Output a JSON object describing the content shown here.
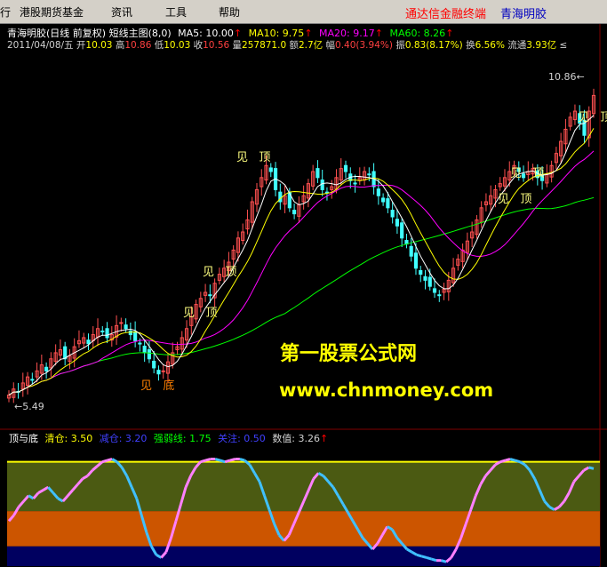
{
  "menubar": {
    "items": [
      "行",
      "港股期货基金",
      "资讯",
      "工具",
      "帮助"
    ],
    "brand": "通达信金融终端",
    "stock_name": "青海明胶"
  },
  "header": {
    "title": "青海明胶(日线 前复权) 短线主图(8,0)",
    "ma": [
      {
        "label": "MA5: 10.00",
        "color": "#ffffff"
      },
      {
        "label": "MA10: 9.75",
        "color": "#ffff00"
      },
      {
        "label": "MA20: 9.17",
        "color": "#ff00ff"
      },
      {
        "label": "MA60: 8.26",
        "color": "#00ff00"
      }
    ],
    "quote": {
      "date": "2011/04/08/五",
      "open_label": "开",
      "open": "10.03",
      "high_label": "高",
      "high": "10.86",
      "low_label": "低",
      "low": "10.03",
      "close_label": "收",
      "close": "10.56",
      "volume_label": "量",
      "volume": "257871.0",
      "amount_label": "额",
      "amount": "2.7亿",
      "change_label": "幅",
      "change": "0.40(3.94%)",
      "amplitude_label": "振",
      "amplitude": "0.83(8.17%)",
      "turnover_label": "换",
      "turnover": "6.56%",
      "float_label": "流通",
      "float": "3.93亿",
      "trailing": "≤"
    },
    "up_arrow": "↑"
  },
  "price_labels": {
    "high": "10.86",
    "low": "5.49",
    "high_arrow": "←",
    "low_arrow": "←"
  },
  "signals": {
    "top_a": "见",
    "top_b": "顶",
    "bottom_a": "见",
    "bottom_b": "底"
  },
  "watermark": {
    "line1": "第一股票公式网",
    "line2": "www.chnmoney.com"
  },
  "indicator": {
    "name": "顶与底",
    "items": [
      {
        "label": "清仓: 3.50",
        "color": "#ffff00"
      },
      {
        "label": "减仓: 3.20",
        "color": "#4040ff"
      },
      {
        "label": "强弱线: 1.75",
        "color": "#00ff00"
      },
      {
        "label": "关注: 0.50",
        "color": "#4040ff"
      },
      {
        "label": "数值: 3.26",
        "color": "#d0d0d0"
      }
    ]
  },
  "colors": {
    "background": "#000000",
    "up_candle": "#ff5050",
    "down_candle": "#40ffff",
    "ma5": "#ffffff",
    "ma10": "#ffff00",
    "ma20": "#ff00ff",
    "ma60": "#00ff00",
    "zone_olive": "#4b5a12",
    "zone_orange": "#cc5500",
    "zone_navy": "#000060",
    "clear_line": "#ffff00",
    "indicator_up": "#ff80ff",
    "indicator_down": "#40c0ff",
    "grid": "#800000"
  },
  "chart_data": {
    "type": "candlestick",
    "title": "青海明胶(日线 前复权) 短线主图(8,0)",
    "price_range": [
      5.49,
      10.86
    ],
    "last_ma": {
      "MA5": 10.0,
      "MA10": 9.75,
      "MA20": 9.17,
      "MA60": 8.26
    },
    "close_path": [
      5.6,
      5.7,
      5.65,
      5.8,
      5.9,
      5.85,
      6.0,
      6.1,
      6.0,
      6.2,
      6.3,
      6.35,
      6.2,
      6.25,
      6.4,
      6.5,
      6.55,
      6.45,
      6.6,
      6.7,
      6.65,
      6.55,
      6.6,
      6.75,
      6.8,
      6.7,
      6.6,
      6.5,
      6.45,
      6.3,
      6.2,
      6.05,
      5.95,
      6.0,
      6.15,
      6.3,
      6.4,
      6.55,
      6.7,
      6.9,
      7.1,
      7.2,
      7.3,
      7.25,
      7.45,
      7.6,
      7.7,
      7.8,
      8.0,
      8.2,
      8.3,
      8.5,
      8.8,
      9.0,
      9.2,
      9.4,
      9.3,
      9.0,
      8.8,
      8.9,
      8.7,
      8.6,
      8.75,
      8.9,
      9.1,
      9.3,
      9.2,
      9.0,
      8.95,
      9.05,
      9.2,
      9.35,
      9.3,
      9.15,
      9.1,
      9.2,
      9.3,
      9.25,
      9.05,
      8.9,
      8.8,
      8.7,
      8.55,
      8.4,
      8.2,
      8.1,
      7.9,
      7.7,
      7.6,
      7.5,
      7.4,
      7.3,
      7.25,
      7.35,
      7.5,
      7.7,
      7.85,
      8.0,
      8.15,
      8.3,
      8.5,
      8.7,
      8.8,
      8.9,
      9.0,
      9.1,
      9.2,
      9.3,
      9.4,
      9.3,
      9.2,
      9.3,
      9.35,
      9.2,
      9.15,
      9.25,
      9.4,
      9.6,
      9.8,
      10.0,
      10.2,
      10.3,
      10.1,
      9.9,
      10.3,
      10.56
    ],
    "indicator_values_path": [
      1.4,
      1.6,
      1.9,
      2.1,
      2.3,
      2.2,
      2.4,
      2.5,
      2.6,
      2.4,
      2.2,
      2.1,
      2.3,
      2.5,
      2.7,
      2.9,
      3.0,
      3.2,
      3.35,
      3.5,
      3.55,
      3.6,
      3.5,
      3.3,
      3.0,
      2.6,
      2.2,
      1.6,
      1.0,
      0.5,
      0.2,
      0.1,
      0.3,
      0.8,
      1.4,
      2.0,
      2.6,
      3.0,
      3.3,
      3.5,
      3.55,
      3.6,
      3.6,
      3.55,
      3.5,
      3.55,
      3.6,
      3.6,
      3.55,
      3.4,
      3.1,
      2.8,
      2.3,
      1.8,
      1.3,
      0.9,
      0.7,
      0.9,
      1.3,
      1.7,
      2.1,
      2.5,
      2.9,
      3.1,
      3.0,
      2.8,
      2.6,
      2.3,
      2.0,
      1.7,
      1.4,
      1.1,
      0.8,
      0.6,
      0.4,
      0.6,
      0.9,
      1.2,
      1.1,
      0.8,
      0.6,
      0.4,
      0.3,
      0.2,
      0.15,
      0.1,
      0.05,
      0.0,
      0.0,
      -0.05,
      0.1,
      0.4,
      0.8,
      1.3,
      1.8,
      2.3,
      2.7,
      3.0,
      3.2,
      3.4,
      3.5,
      3.55,
      3.6,
      3.55,
      3.5,
      3.4,
      3.2,
      2.9,
      2.5,
      2.1,
      1.9,
      1.8,
      1.9,
      2.1,
      2.4,
      2.8,
      3.0,
      3.2,
      3.3,
      3.26
    ]
  }
}
